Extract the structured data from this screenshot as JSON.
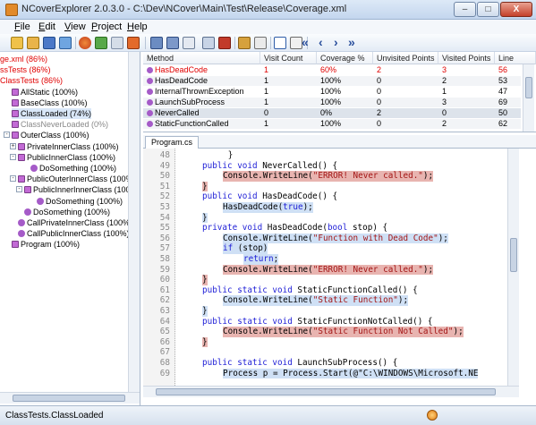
{
  "window": {
    "title": "NCoverExplorer 2.0.3.0 - C:\\Dev\\NCover\\Main\\Test\\Release\\Coverage.xml",
    "minimize": "–",
    "maximize": "□",
    "close": "X"
  },
  "menu": [
    {
      "key": "F",
      "rest": "ile"
    },
    {
      "key": "E",
      "rest": "dit"
    },
    {
      "key": "V",
      "rest": "iew"
    },
    {
      "key": "P",
      "rest": "roject"
    },
    {
      "key": "H",
      "rest": "elp"
    }
  ],
  "toolbar": {
    "nav": [
      "«",
      "‹",
      "›",
      "»"
    ]
  },
  "tree": [
    {
      "text": "ge.xml (86%)",
      "color": "red",
      "icon": "none",
      "indent": 0
    },
    {
      "text": "ssTests (86%)",
      "color": "red",
      "icon": "none",
      "indent": 0
    },
    {
      "text": "ClassTests (86%)",
      "color": "red",
      "icon": "none",
      "indent": 0
    },
    {
      "text": "AllStatic (100%)",
      "color": "normal",
      "icon": "cls",
      "indent": 1
    },
    {
      "text": "BaseClass (100%)",
      "color": "normal",
      "icon": "cls",
      "indent": 1
    },
    {
      "text": "ClassLoaded (74%)",
      "color": "normal",
      "icon": "cls",
      "indent": 1,
      "selected": true
    },
    {
      "text": "ClassNeverLoaded (0%)",
      "color": "grey",
      "icon": "cls",
      "indent": 1
    },
    {
      "text": "OuterClass (100%)",
      "color": "normal",
      "icon": "cls",
      "indent": 1,
      "expander": "-"
    },
    {
      "text": "PrivateInnerClass (100%)",
      "color": "normal",
      "icon": "cls",
      "indent": 2,
      "expander": "+"
    },
    {
      "text": "PublicInnerClass (100%)",
      "color": "normal",
      "icon": "cls",
      "indent": 2,
      "expander": "-"
    },
    {
      "text": "DoSomething (100%)",
      "color": "normal",
      "icon": "meth",
      "indent": 4
    },
    {
      "text": "PublicOuterInnerClass (100%)",
      "color": "normal",
      "icon": "cls",
      "indent": 2,
      "expander": "-"
    },
    {
      "text": "PublicInnerInnerClass (100%)",
      "color": "normal",
      "icon": "cls",
      "indent": 3,
      "expander": "-"
    },
    {
      "text": "DoSomething (100%)",
      "color": "normal",
      "icon": "meth",
      "indent": 5
    },
    {
      "text": "DoSomething (100%)",
      "color": "normal",
      "icon": "meth",
      "indent": 3
    },
    {
      "text": "CallPrivateInnerClass (100%)",
      "color": "normal",
      "icon": "meth",
      "indent": 2
    },
    {
      "text": "CallPublicInnerClass (100%)",
      "color": "normal",
      "icon": "meth",
      "indent": 2
    },
    {
      "text": "Program (100%)",
      "color": "normal",
      "icon": "cls",
      "indent": 1
    }
  ],
  "grid": {
    "columns": [
      "Method",
      "Visit Count",
      "Coverage %",
      "Unvisited Points",
      "Visited Points",
      "Line"
    ],
    "rows": [
      {
        "cells": [
          "HasDeadCode",
          "1",
          "60%",
          "2",
          "3",
          "56"
        ],
        "red": true
      },
      {
        "cells": [
          "HasDeadCode",
          "1",
          "100%",
          "0",
          "2",
          "53"
        ]
      },
      {
        "cells": [
          "InternalThrownException",
          "1",
          "100%",
          "0",
          "1",
          "47"
        ]
      },
      {
        "cells": [
          "LaunchSubProcess",
          "1",
          "100%",
          "0",
          "3",
          "69"
        ]
      },
      {
        "cells": [
          "NeverCalled",
          "0",
          "0%",
          "2",
          "0",
          "50"
        ],
        "selected": true
      },
      {
        "cells": [
          "StaticFunctionCalled",
          "1",
          "100%",
          "0",
          "2",
          "62"
        ]
      }
    ]
  },
  "file_tab": "Program.cs",
  "code": [
    {
      "n": "48",
      "text": "        }",
      "hl": "none",
      "indent": 0
    },
    {
      "n": "49",
      "text": "public void NeverCalled() {",
      "hl": "none",
      "indent": 1
    },
    {
      "n": "50",
      "text": "Console.WriteLine(\"ERROR! Never called.\");",
      "hl": "red",
      "indent": 2
    },
    {
      "n": "51",
      "text": "}",
      "hl": "red",
      "indent": 1
    },
    {
      "n": "52",
      "text": "public void HasDeadCode() {",
      "hl": "none",
      "indent": 1
    },
    {
      "n": "53",
      "text": "HasDeadCode(true);",
      "hl": "blue",
      "indent": 2
    },
    {
      "n": "54",
      "text": "}",
      "hl": "blue",
      "indent": 1
    },
    {
      "n": "55",
      "text": "private void HasDeadCode(bool stop) {",
      "hl": "none",
      "indent": 1
    },
    {
      "n": "56",
      "text": "Console.WriteLine(\"Function with Dead Code\");",
      "hl": "blue",
      "indent": 2
    },
    {
      "n": "57",
      "text": "if (stop)",
      "hl": "blue",
      "indent": 2
    },
    {
      "n": "58",
      "text": "return;",
      "hl": "blue",
      "indent": 3
    },
    {
      "n": "59",
      "text": "Console.WriteLine(\"ERROR! Never called.\");",
      "hl": "red",
      "indent": 2
    },
    {
      "n": "60",
      "text": "}",
      "hl": "red",
      "indent": 1
    },
    {
      "n": "61",
      "text": "public static void StaticFunctionCalled() {",
      "hl": "none",
      "indent": 1
    },
    {
      "n": "62",
      "text": "Console.WriteLine(\"Static Function\");",
      "hl": "blue",
      "indent": 2
    },
    {
      "n": "63",
      "text": "}",
      "hl": "blue",
      "indent": 1
    },
    {
      "n": "64",
      "text": "public static void StaticFunctionNotCalled() {",
      "hl": "none",
      "indent": 1
    },
    {
      "n": "65",
      "text": "Console.WriteLine(\"Static Function Not Called\");",
      "hl": "red",
      "indent": 2
    },
    {
      "n": "66",
      "text": "}",
      "hl": "red",
      "indent": 1
    },
    {
      "n": "67",
      "text": "",
      "hl": "none",
      "indent": 0
    },
    {
      "n": "68",
      "text": "public static void LaunchSubProcess() {",
      "hl": "none",
      "indent": 1
    },
    {
      "n": "69",
      "text": "Process p = Process.Start(@\"C:\\WINDOWS\\Microsoft.NE",
      "hl": "blue",
      "indent": 2
    }
  ],
  "status": {
    "text": "ClassTests.ClassLoaded"
  },
  "colors": {
    "covered": "#cfe0f5",
    "uncovered": "#e8b4b0",
    "error_text": "#e00000"
  }
}
